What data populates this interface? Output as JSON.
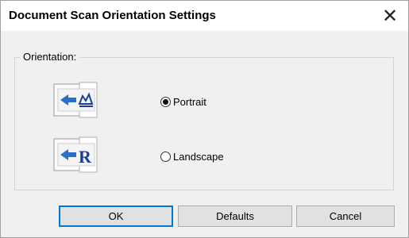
{
  "dialog": {
    "title": "Document Scan Orientation Settings",
    "close_glyph": "✕"
  },
  "orientation": {
    "group_label": "Orientation:",
    "options": [
      {
        "label": "Portrait",
        "selected": true,
        "icon": "portrait-orientation-icon"
      },
      {
        "label": "Landscape",
        "selected": false,
        "icon": "landscape-orientation-icon"
      }
    ]
  },
  "buttons": {
    "ok": "OK",
    "defaults": "Defaults",
    "cancel": "Cancel"
  },
  "colors": {
    "arrow_blue": "#2a6fc9",
    "glyph_blue": "#1a3e9e",
    "default_button_border": "#0078d7"
  }
}
